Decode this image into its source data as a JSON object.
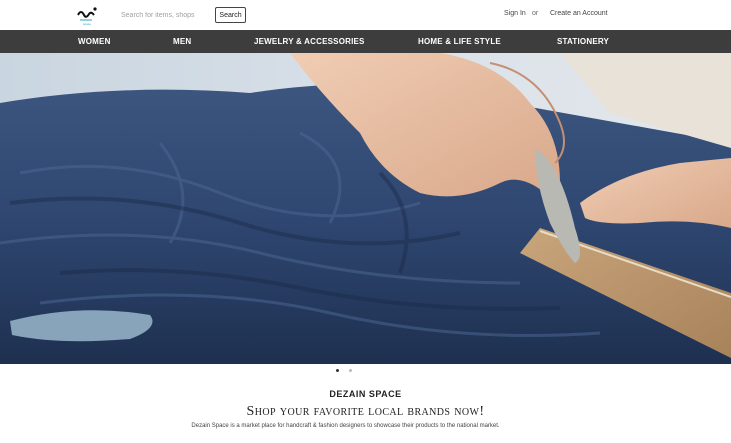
{
  "header": {
    "logo_alt": "logo",
    "search_placeholder": "Search for items, shops",
    "search_button": "Search",
    "sign_in": "Sign In",
    "or": "or",
    "create_account": "Create an Account"
  },
  "nav": {
    "items": [
      "WOMEN",
      "MEN",
      "JEWELRY & ACCESSORIES",
      "HOME & LIFE STYLE",
      "STATIONERY"
    ]
  },
  "carousel": {
    "slide_count": 2,
    "active_slide": 1
  },
  "intro": {
    "brand": "DEZAIN SPACE",
    "headline": "Shop your favorite local brands now!",
    "description": "Dezain Space is a market place for handcraft & fashion designers to showcase their products to the national market."
  }
}
